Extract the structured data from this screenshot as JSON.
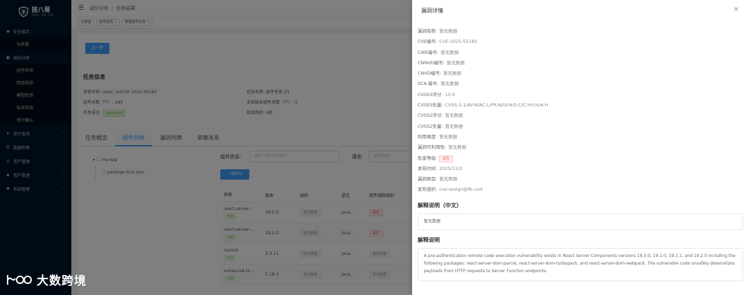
{
  "sidebar": {
    "logo_text": "技八哥",
    "logo_sub": "JIBA GE.CN",
    "items": [
      {
        "label": "安全展示",
        "icon": "dashboard-icon"
      },
      {
        "label": "仪表盘",
        "sub": true
      },
      {
        "label": "成份分析",
        "icon": "grid-icon"
      },
      {
        "label": "组件检测",
        "sub": true
      },
      {
        "label": "制品检测",
        "sub": true
      },
      {
        "label": "模型检测",
        "sub": true
      },
      {
        "label": "私库检测",
        "sub": true
      },
      {
        "label": "审计确认",
        "sub": true
      },
      {
        "label": "审计查询",
        "icon": "send-icon"
      },
      {
        "label": "数据检索",
        "icon": "db-icon"
      },
      {
        "label": "资产管理",
        "icon": "eye-icon"
      },
      {
        "label": "用户管理",
        "icon": "users-icon"
      },
      {
        "label": "系统管理",
        "icon": "gear-icon"
      }
    ]
  },
  "topbar": {
    "breadcrumb_1": "成份分析",
    "breadcrumb_2": "任务结果"
  },
  "tags": [
    {
      "label": "仪表盘",
      "closable": false
    },
    {
      "label": "组件检测",
      "closable": true
    },
    {
      "label": "新建组件任务",
      "closable": true
    }
  ],
  "main": {
    "back_label": "上一步",
    "section_title": "任务信息",
    "project_name": "项目名称:  react_rceCVE-2025-55182",
    "component_total": "组件总数（个）:  285",
    "dev_lang_label": "开发语言:",
    "dev_lang_value": "javascript",
    "task_name": "任务名称:  组件任务-23",
    "unlicensed": "未知版本组件总数（个）:  0",
    "duration": "检测用时:  4秒",
    "tabs": [
      "任务概览",
      "组件列表",
      "漏洞列表",
      "依赖关系"
    ],
    "tree": {
      "root": "my-app",
      "child": "package-lock.json"
    },
    "filter_label": "组件信息:",
    "filter_placeholder": "请输入组件名称/版本",
    "lang_label": "语言:",
    "lang_placeholder": "请选择语言",
    "export_btn": "一键导出",
    "table": {
      "headers": [
        "名称",
        "版本",
        "组织",
        "语言",
        "组件威胁级别"
      ],
      "rows": [
        {
          "name": "react-server-...",
          "status": "开源",
          "version": "19.2.0",
          "org": "暂无数据",
          "lang": "Java...",
          "level": "超危",
          "level_type": "red"
        },
        {
          "name": "react-server-...",
          "status": "开源",
          "version": "19.2.0",
          "org": "暂无数据",
          "lang": "Java...",
          "level": "超危",
          "level_type": "red"
        },
        {
          "name": "nanoid",
          "status": "开源",
          "version": "3.3.11",
          "org": "暂无数据",
          "lang": "Java...",
          "level": "暂无数据",
          "level_type": "gray"
        },
        {
          "name": "enhanced-re...",
          "status": "开源",
          "version": "5.18.3",
          "org": "暂无数据",
          "lang": "Java...",
          "level": "暂无数据",
          "level_type": "gray"
        }
      ]
    }
  },
  "drawer": {
    "title": "漏洞详情",
    "fields": [
      {
        "k": "漏洞名称:",
        "v": "暂无数据"
      },
      {
        "k": "CVE编号:",
        "v": "CVE-2025-55182"
      },
      {
        "k": "CWE编号:",
        "v": "暂无数据"
      },
      {
        "k": "CNNVD编号:",
        "v": "暂无数据"
      },
      {
        "k": "CNVD编号:",
        "v": "暂无数据"
      },
      {
        "k": "SCA 编号:",
        "v": "暂无数据"
      },
      {
        "k": "CVSS3评分:",
        "v": "10.0"
      },
      {
        "k": "CVSS3矢量:",
        "v": "CVSS:3.1/AV:N/AC:L/PR:N/UI:N/S:C/C:H/I:H/A:H"
      },
      {
        "k": "CVSS2评分:",
        "v": "暂无数据"
      },
      {
        "k": "CVSS2矢量:",
        "v": "暂无数据"
      },
      {
        "k": "利用难度:",
        "v": "暂无数据"
      },
      {
        "k": "漏洞可利用性:",
        "v": "暂无数据"
      },
      {
        "k": "危害等级:",
        "v": "超危",
        "badge": true
      },
      {
        "k": "发布时间:",
        "v": "2025/12/3"
      },
      {
        "k": "漏洞类型:",
        "v": "暂无数据"
      },
      {
        "k": "发布组织:",
        "v": "cve-assign@fb.com"
      }
    ],
    "desc_cn_title": "解释说明（中文）",
    "desc_cn": "暂无数据",
    "desc_title": "解释说明",
    "desc": "A pre-authentication remote code execution vulnerability exists in React Server Components versions 19.0.0, 19.1.0, 19.1.1, and 19.2.0 including the following packages: react-server-dom-parcel, react-server-dom-turbopack, and react-server-dom-webpack. The vulnerable code unsafely deserializes payloads from HTTP requests to Server Function endpoints."
  },
  "watermark": {
    "text": "大数跨境"
  }
}
